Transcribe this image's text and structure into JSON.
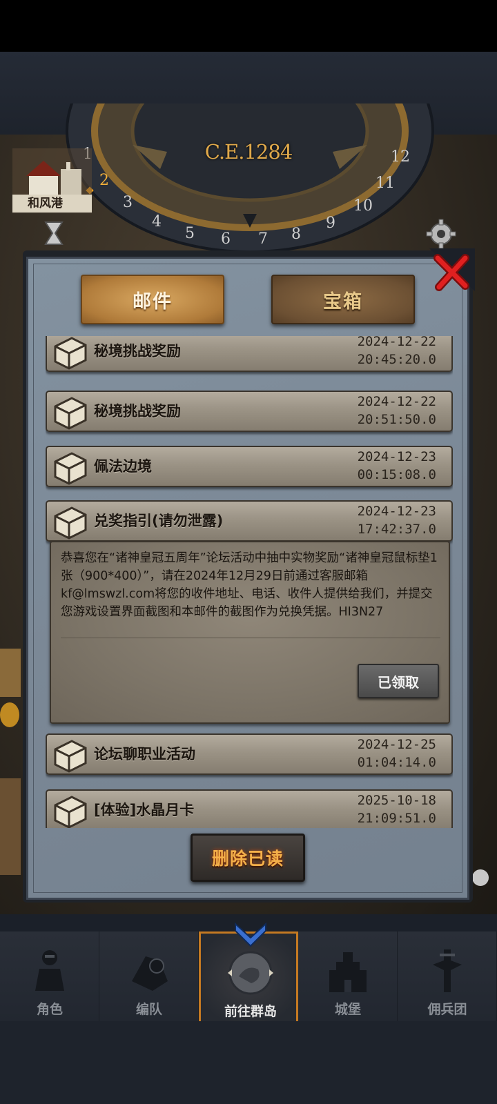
{
  "top": {
    "era": "C.E.1284",
    "location_label": "和风港",
    "dial_numbers": [
      "1",
      "2",
      "3",
      "4",
      "5",
      "6",
      "7",
      "8",
      "9",
      "10",
      "11",
      "12"
    ]
  },
  "tabs": [
    {
      "label": "邮件",
      "active": true
    },
    {
      "label": "宝箱",
      "active": false
    }
  ],
  "mails": [
    {
      "title": "秘境挑战奖励",
      "date": "2024-12-22",
      "time": "20:45:20.0"
    },
    {
      "title": "秘境挑战奖励",
      "date": "2024-12-22",
      "time": "20:51:50.0"
    },
    {
      "title": "佩法边境",
      "date": "2024-12-23",
      "time": "00:15:08.0"
    },
    {
      "title": "兑奖指引(请勿泄露)",
      "date": "2024-12-23",
      "time": "17:42:37.0"
    },
    {
      "title": "论坛聊职业活动",
      "date": "2024-12-25",
      "time": "01:04:14.0"
    },
    {
      "title": "[体验]水晶月卡",
      "date": "2025-10-18",
      "time": "21:09:51.0"
    }
  ],
  "opened_mail": {
    "body": "恭喜您在“诸神皇冠五周年”论坛活动中抽中实物奖励“诸神皇冠鼠标垫1张（900*400）”，请在2024年12月29日前通过客服邮箱kf@lmswzl.com将您的收件地址、电话、收件人提供给我们，并提交您游戏设置界面截图和本邮件的截图作为兑换凭据。HI3N27",
    "claimed_label": "已领取"
  },
  "delete_read_label": "删除已读",
  "bottom_nav": [
    {
      "label": "角色",
      "icon": "knight-icon"
    },
    {
      "label": "编队",
      "icon": "formation-icon"
    },
    {
      "label": "前往群岛",
      "icon": "islands-icon",
      "active": true
    },
    {
      "label": "城堡",
      "icon": "castle-icon"
    },
    {
      "label": "佣兵团",
      "icon": "mercenary-icon"
    }
  ],
  "colors": {
    "accent_gold": "#e0a94a",
    "active_nav_border": "#c57a22",
    "delete_text": "#f4b04a",
    "close_red": "#e02020"
  }
}
